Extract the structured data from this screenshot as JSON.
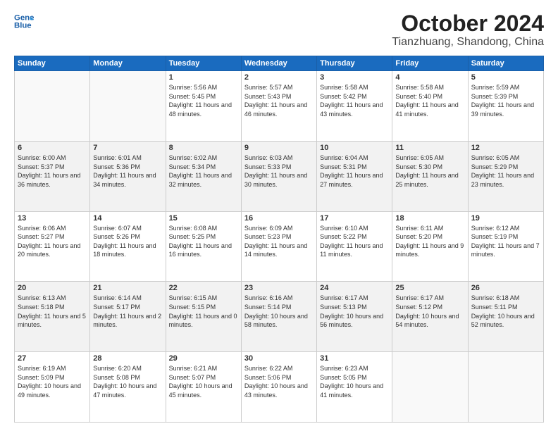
{
  "header": {
    "logo_line1": "General",
    "logo_line2": "Blue",
    "title": "October 2024",
    "subtitle": "Tianzhuang, Shandong, China"
  },
  "weekdays": [
    "Sunday",
    "Monday",
    "Tuesday",
    "Wednesday",
    "Thursday",
    "Friday",
    "Saturday"
  ],
  "weeks": [
    [
      {
        "day": "",
        "info": ""
      },
      {
        "day": "",
        "info": ""
      },
      {
        "day": "1",
        "info": "Sunrise: 5:56 AM\nSunset: 5:45 PM\nDaylight: 11 hours and 48 minutes."
      },
      {
        "day": "2",
        "info": "Sunrise: 5:57 AM\nSunset: 5:43 PM\nDaylight: 11 hours and 46 minutes."
      },
      {
        "day": "3",
        "info": "Sunrise: 5:58 AM\nSunset: 5:42 PM\nDaylight: 11 hours and 43 minutes."
      },
      {
        "day": "4",
        "info": "Sunrise: 5:58 AM\nSunset: 5:40 PM\nDaylight: 11 hours and 41 minutes."
      },
      {
        "day": "5",
        "info": "Sunrise: 5:59 AM\nSunset: 5:39 PM\nDaylight: 11 hours and 39 minutes."
      }
    ],
    [
      {
        "day": "6",
        "info": "Sunrise: 6:00 AM\nSunset: 5:37 PM\nDaylight: 11 hours and 36 minutes."
      },
      {
        "day": "7",
        "info": "Sunrise: 6:01 AM\nSunset: 5:36 PM\nDaylight: 11 hours and 34 minutes."
      },
      {
        "day": "8",
        "info": "Sunrise: 6:02 AM\nSunset: 5:34 PM\nDaylight: 11 hours and 32 minutes."
      },
      {
        "day": "9",
        "info": "Sunrise: 6:03 AM\nSunset: 5:33 PM\nDaylight: 11 hours and 30 minutes."
      },
      {
        "day": "10",
        "info": "Sunrise: 6:04 AM\nSunset: 5:31 PM\nDaylight: 11 hours and 27 minutes."
      },
      {
        "day": "11",
        "info": "Sunrise: 6:05 AM\nSunset: 5:30 PM\nDaylight: 11 hours and 25 minutes."
      },
      {
        "day": "12",
        "info": "Sunrise: 6:05 AM\nSunset: 5:29 PM\nDaylight: 11 hours and 23 minutes."
      }
    ],
    [
      {
        "day": "13",
        "info": "Sunrise: 6:06 AM\nSunset: 5:27 PM\nDaylight: 11 hours and 20 minutes."
      },
      {
        "day": "14",
        "info": "Sunrise: 6:07 AM\nSunset: 5:26 PM\nDaylight: 11 hours and 18 minutes."
      },
      {
        "day": "15",
        "info": "Sunrise: 6:08 AM\nSunset: 5:25 PM\nDaylight: 11 hours and 16 minutes."
      },
      {
        "day": "16",
        "info": "Sunrise: 6:09 AM\nSunset: 5:23 PM\nDaylight: 11 hours and 14 minutes."
      },
      {
        "day": "17",
        "info": "Sunrise: 6:10 AM\nSunset: 5:22 PM\nDaylight: 11 hours and 11 minutes."
      },
      {
        "day": "18",
        "info": "Sunrise: 6:11 AM\nSunset: 5:20 PM\nDaylight: 11 hours and 9 minutes."
      },
      {
        "day": "19",
        "info": "Sunrise: 6:12 AM\nSunset: 5:19 PM\nDaylight: 11 hours and 7 minutes."
      }
    ],
    [
      {
        "day": "20",
        "info": "Sunrise: 6:13 AM\nSunset: 5:18 PM\nDaylight: 11 hours and 5 minutes."
      },
      {
        "day": "21",
        "info": "Sunrise: 6:14 AM\nSunset: 5:17 PM\nDaylight: 11 hours and 2 minutes."
      },
      {
        "day": "22",
        "info": "Sunrise: 6:15 AM\nSunset: 5:15 PM\nDaylight: 11 hours and 0 minutes."
      },
      {
        "day": "23",
        "info": "Sunrise: 6:16 AM\nSunset: 5:14 PM\nDaylight: 10 hours and 58 minutes."
      },
      {
        "day": "24",
        "info": "Sunrise: 6:17 AM\nSunset: 5:13 PM\nDaylight: 10 hours and 56 minutes."
      },
      {
        "day": "25",
        "info": "Sunrise: 6:17 AM\nSunset: 5:12 PM\nDaylight: 10 hours and 54 minutes."
      },
      {
        "day": "26",
        "info": "Sunrise: 6:18 AM\nSunset: 5:11 PM\nDaylight: 10 hours and 52 minutes."
      }
    ],
    [
      {
        "day": "27",
        "info": "Sunrise: 6:19 AM\nSunset: 5:09 PM\nDaylight: 10 hours and 49 minutes."
      },
      {
        "day": "28",
        "info": "Sunrise: 6:20 AM\nSunset: 5:08 PM\nDaylight: 10 hours and 47 minutes."
      },
      {
        "day": "29",
        "info": "Sunrise: 6:21 AM\nSunset: 5:07 PM\nDaylight: 10 hours and 45 minutes."
      },
      {
        "day": "30",
        "info": "Sunrise: 6:22 AM\nSunset: 5:06 PM\nDaylight: 10 hours and 43 minutes."
      },
      {
        "day": "31",
        "info": "Sunrise: 6:23 AM\nSunset: 5:05 PM\nDaylight: 10 hours and 41 minutes."
      },
      {
        "day": "",
        "info": ""
      },
      {
        "day": "",
        "info": ""
      }
    ]
  ]
}
